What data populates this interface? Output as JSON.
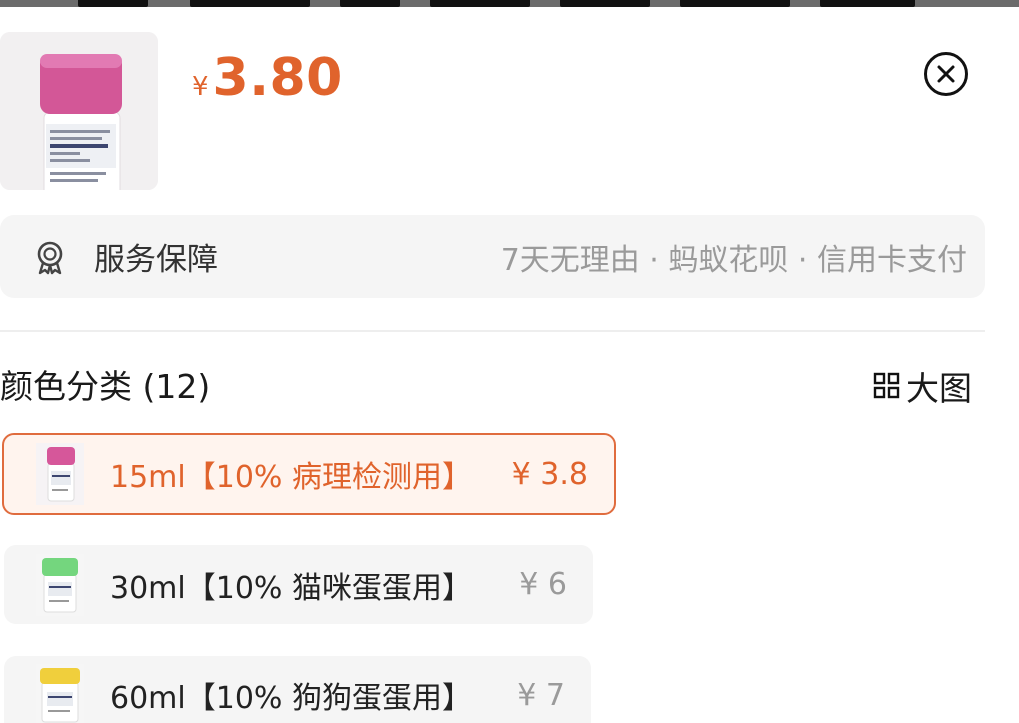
{
  "product": {
    "currency_symbol": "¥",
    "price": "3.80",
    "image_name": "specimen-bottle-pink-cap"
  },
  "close_icon": "close-circle-icon",
  "service": {
    "icon": "badge-icon",
    "label": "服务保障",
    "description": "7天无理由 · 蚂蚁花呗 · 信用卡支付"
  },
  "category": {
    "title": "颜色分类 (12)",
    "big_image_label": "大图",
    "big_image_icon": "grid-icon"
  },
  "options": [
    {
      "name": "15ml【10% 病理检测用】",
      "price": "¥ 3.8",
      "cap_color": "#d6579a",
      "selected": true
    },
    {
      "name": "30ml【10% 猫咪蛋蛋用】",
      "price": "¥ 6",
      "cap_color": "#74d67e",
      "selected": false
    },
    {
      "name": "60ml【10% 狗狗蛋蛋用】",
      "price": "¥ 7",
      "cap_color": "#f0cf3c",
      "selected": false
    }
  ],
  "colors": {
    "accent": "#e0632c",
    "selected_border": "#e06c3e",
    "muted_text": "#9a9a9a",
    "panel_bg": "#f5f5f5"
  }
}
